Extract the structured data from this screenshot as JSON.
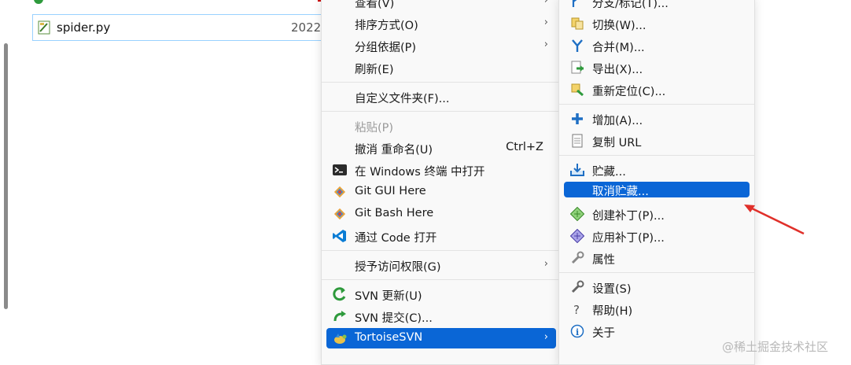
{
  "file": {
    "name": "spider.py",
    "date": "2022"
  },
  "left_menu": {
    "view": "查看(V)",
    "sort": "排序方式(O)",
    "group": "分组依据(P)",
    "refresh": "刷新(E)",
    "customize": "自定义文件夹(F)...",
    "paste": "粘贴(P)",
    "undo": "撤消 重命名(U)",
    "undo_shortcut": "Ctrl+Z",
    "terminal": "在 Windows 终端 中打开",
    "git_gui": "Git GUI Here",
    "git_bash": "Git Bash Here",
    "vscode": "通过 Code 打开",
    "access": "授予访问权限(G)",
    "svn_update": "SVN 更新(U)",
    "svn_commit": "SVN 提交(C)...",
    "tortoise": "TortoiseSVN",
    "arrow": "›"
  },
  "right_menu": {
    "branch": "分支/标记(T)...",
    "switch": "切换(W)...",
    "merge": "合并(M)...",
    "export": "导出(X)...",
    "relocate": "重新定位(C)...",
    "add": "增加(A)...",
    "copy_url": "复制 URL",
    "shelve": "贮藏...",
    "unshelve": "取消贮藏...",
    "create_patch": "创建补丁(P)...",
    "apply_patch": "应用补丁(P)...",
    "properties": "属性",
    "settings": "设置(S)",
    "help": "帮助(H)",
    "about": "关于"
  },
  "watermark": "@稀土掘金技术社区",
  "colors": {
    "accent": "#0a66d6",
    "annotation": "#e0302a"
  }
}
